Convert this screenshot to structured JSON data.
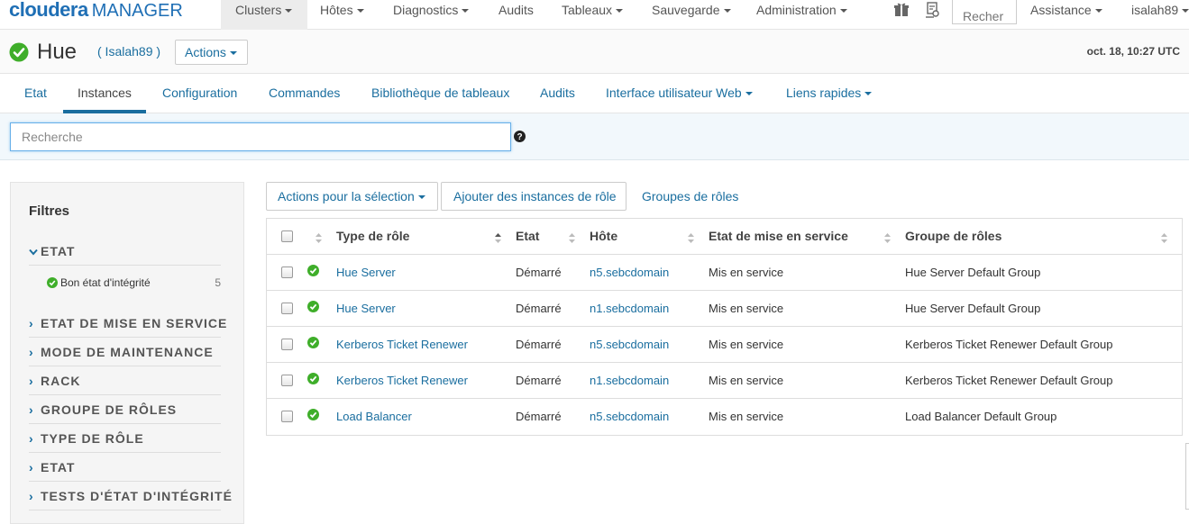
{
  "brand": {
    "name": "cloudera",
    "product": "MANAGER"
  },
  "topnav": {
    "items": [
      {
        "label": "Clusters",
        "dropdown": true,
        "active": true
      },
      {
        "label": "Hôtes",
        "dropdown": true
      },
      {
        "label": "Diagnostics",
        "dropdown": true
      },
      {
        "label": "Audits",
        "dropdown": false
      },
      {
        "label": "Tableaux",
        "dropdown": true
      },
      {
        "label": "Sauvegarde",
        "dropdown": true
      },
      {
        "label": "Administration",
        "dropdown": true
      }
    ],
    "search_placeholder": "Recher",
    "assistance": "Assistance",
    "user": "isalah89",
    "icons": [
      "gift-icon",
      "parcels-icon"
    ]
  },
  "service": {
    "name": "Hue",
    "cluster": "( Isalah89 )",
    "actions_label": "Actions",
    "status": "good-health",
    "timestamp": "oct. 18, 10:27 UTC"
  },
  "subnav": {
    "items": [
      "Etat",
      "Instances",
      "Configuration",
      "Commandes",
      "Bibliothèque de tableaux",
      "Audits",
      "Interface utilisateur Web",
      "Liens rapides"
    ],
    "active": "Instances"
  },
  "search": {
    "placeholder": "Recherche"
  },
  "filters": {
    "title": "Filtres",
    "expanded": {
      "label": "ETAT",
      "option": "Bon état d'intégrité",
      "count": "5"
    },
    "facets": [
      "ETAT DE MISE EN SERVICE",
      "MODE DE MAINTENANCE",
      "RACK",
      "GROUPE DE RÔLES",
      "TYPE DE RÔLE",
      "ETAT",
      "TESTS D'ÉTAT D'INTÉGRITÉ"
    ]
  },
  "toolbar": {
    "selection_actions": "Actions pour la sélection",
    "add_instances": "Ajouter des instances de rôle",
    "role_groups": "Groupes de rôles"
  },
  "table": {
    "columns": [
      "Type de rôle",
      "Etat",
      "Hôte",
      "Etat de mise en service",
      "Groupe de rôles"
    ],
    "rows": [
      {
        "role": "Hue Server",
        "state": "Démarré",
        "host": "n5.sebcdomain",
        "commission": "Mis en service",
        "group": "Hue Server Default Group"
      },
      {
        "role": "Hue Server",
        "state": "Démarré",
        "host": "n1.sebcdomain",
        "commission": "Mis en service",
        "group": "Hue Server Default Group"
      },
      {
        "role": "Kerberos Ticket Renewer",
        "state": "Démarré",
        "host": "n5.sebcdomain",
        "commission": "Mis en service",
        "group": "Kerberos Ticket Renewer Default Group"
      },
      {
        "role": "Kerberos Ticket Renewer",
        "state": "Démarré",
        "host": "n1.sebcdomain",
        "commission": "Mis en service",
        "group": "Kerberos Ticket Renewer Default Group"
      },
      {
        "role": "Load Balancer",
        "state": "Démarré",
        "host": "n5.sebcdomain",
        "commission": "Mis en service",
        "group": "Load Balancer Default Group"
      }
    ]
  },
  "colors": {
    "accent": "#1a6e9f",
    "brand": "#1f6fb5",
    "good": "#3fae2a"
  }
}
